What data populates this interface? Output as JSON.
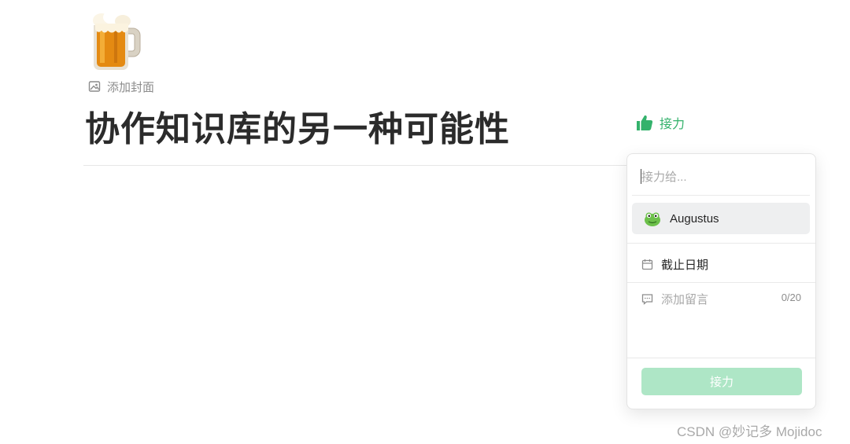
{
  "page": {
    "icon": "beer-mug-emoji",
    "add_cover_label": "添加封面",
    "title": "协作知识库的另一种可能性"
  },
  "relay": {
    "trigger_label": "接力",
    "accent_color": "#34b26c"
  },
  "popover": {
    "search": {
      "placeholder": "接力给...",
      "value": ""
    },
    "users": [
      {
        "name": "Augustus",
        "avatar": "frog-avatar"
      }
    ],
    "due_date_label": "截止日期",
    "message": {
      "placeholder": "添加留言",
      "counter": "0/20"
    },
    "submit_label": "接力",
    "submit_color": "#aee6c6"
  },
  "watermark": "CSDN @妙记多 Mojidoc"
}
